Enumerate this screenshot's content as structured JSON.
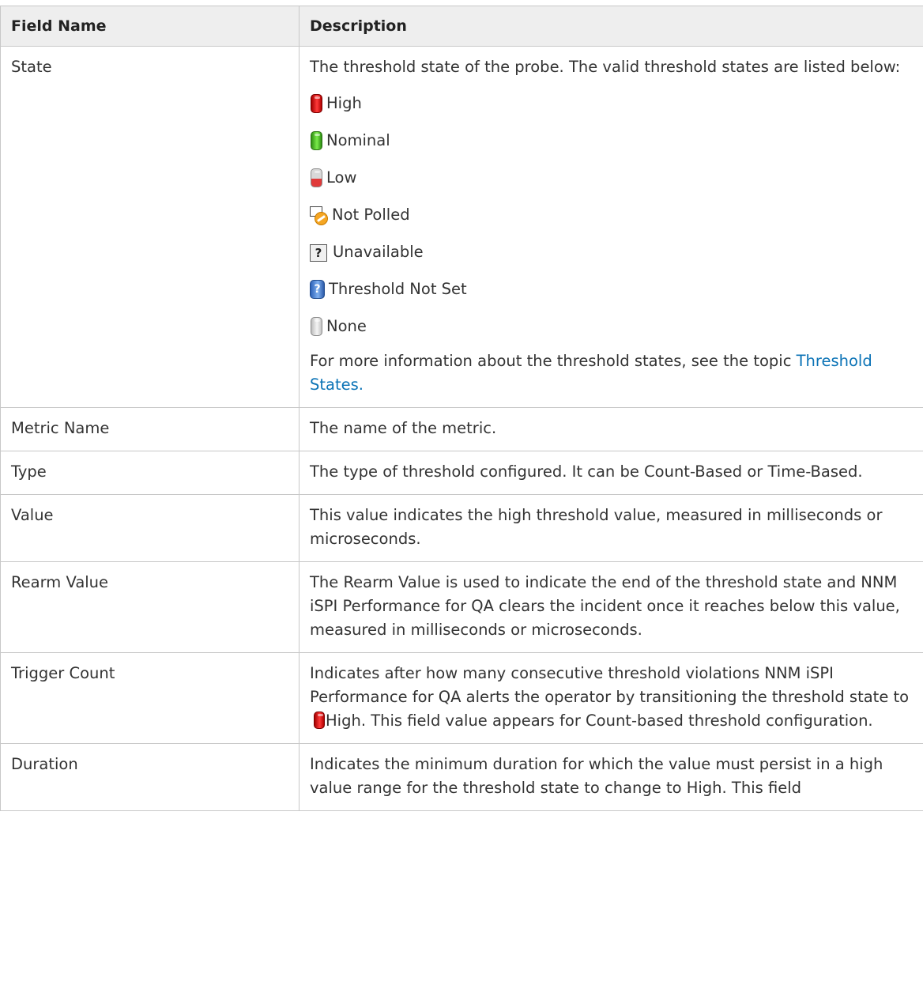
{
  "header": {
    "col1": "Field Name",
    "col2": "Description"
  },
  "rows": {
    "state": {
      "name": "State",
      "desc": "The threshold state of the probe. The valid threshold states are listed below:",
      "states": [
        {
          "label": "High",
          "icon": "high-threshold-icon"
        },
        {
          "label": "Nominal",
          "icon": "nominal-threshold-icon"
        },
        {
          "label": "Low",
          "icon": "low-threshold-icon"
        },
        {
          "label": "Not Polled",
          "icon": "not-polled-icon"
        },
        {
          "label": "Unavailable",
          "icon": "unavailable-icon"
        },
        {
          "label": "Threshold Not Set",
          "icon": "threshold-not-set-icon"
        },
        {
          "label": "None",
          "icon": "none-threshold-icon"
        }
      ],
      "more_info": "For more information about the threshold states, see the topic",
      "more_link": "Threshold States."
    },
    "metric": {
      "name": "Metric Name",
      "desc": "The name of the metric."
    },
    "type": {
      "name": "Type",
      "desc": "The type of threshold configured. It can be Count-Based or Time-Based."
    },
    "value": {
      "name": "Value",
      "desc": "This value indicates the high threshold value, measured in milliseconds or microseconds."
    },
    "rearm": {
      "name": "Rearm Value",
      "desc": "The Rearm Value is used to indicate the end of the threshold state and NNM iSPI Performance for QA clears the incident once it reaches below this value, measured in milliseconds or microseconds."
    },
    "trigger": {
      "name": "Trigger Count",
      "desc_before": "Indicates after how many consecutive threshold violations NNM iSPI Performance for QA alerts the operator by transitioning the threshold state to",
      "desc_high": "High",
      "desc_after": ". This field value appears for Count-based threshold configuration."
    },
    "duration": {
      "name": "Duration",
      "desc": "Indicates the minimum duration for which the value must persist in a high value range for the threshold state to change to High. This field"
    }
  },
  "colors": {
    "link": "#0b73b6",
    "header_bg": "#eeeeee",
    "border": "#c8c8c8"
  }
}
